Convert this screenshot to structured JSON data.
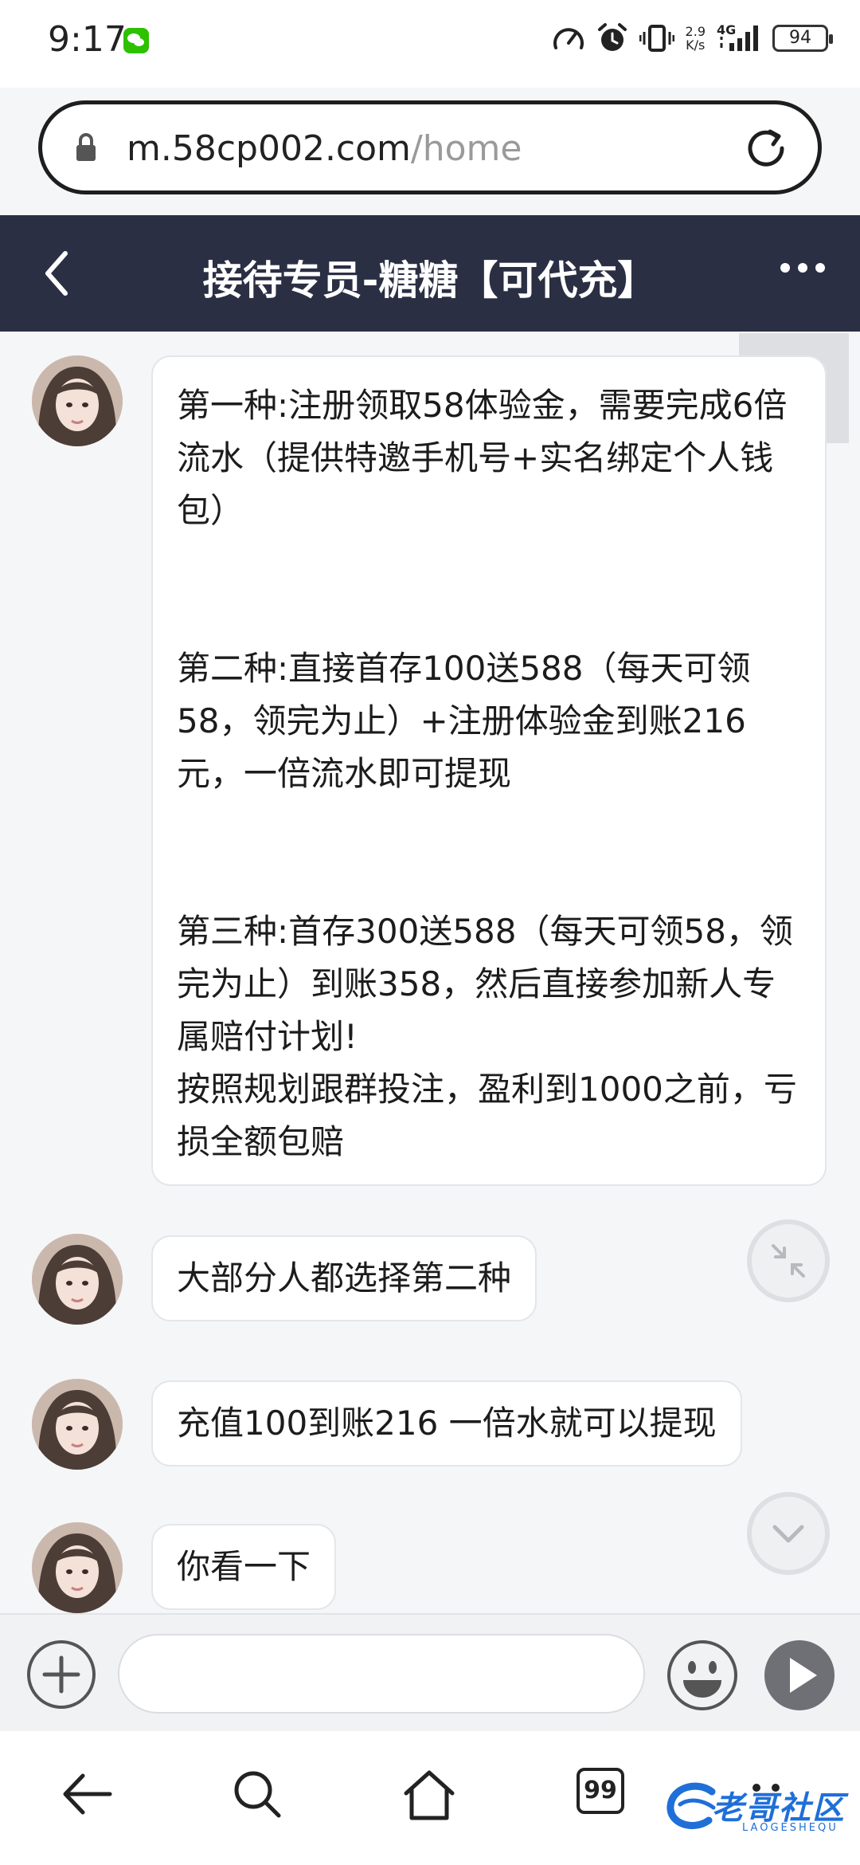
{
  "status_bar": {
    "time": "9:17",
    "net_speed_value": "2.9",
    "net_speed_unit": "K/s",
    "network_type": "4G",
    "battery": "94",
    "icons": [
      "wechat-icon",
      "speedometer-icon",
      "alarm-icon",
      "vibrate-icon",
      "signal-icon"
    ]
  },
  "browser": {
    "url_domain": "m.58cp002.com",
    "url_path": "/home",
    "icons": [
      "lock-icon",
      "reload-icon"
    ]
  },
  "chat": {
    "title": "接待专员-糖糖【可代充】",
    "icons": [
      "back-icon",
      "more-icon"
    ]
  },
  "messages": [
    {
      "sender": "agent",
      "paragraphs": [
        "第一种:注册领取58体验金，需要完成6倍流水（提供特邀手机号+实名绑定个人钱包）",
        "第二种:直接首存100送588（每天可领58，领完为止）+注册体验金到账216元，一倍流水即可提现",
        "第三种:首存300送588（每天可领58，领完为止）到账358，然后直接参加新人专属赔付计划!",
        "按照规划跟群投注，盈利到1000之前，亏损全额包赔"
      ]
    },
    {
      "sender": "agent",
      "text": "大部分人都选择第二种"
    },
    {
      "sender": "agent",
      "text": "充值100到账216 一倍水就可以提现"
    },
    {
      "sender": "agent",
      "text": "你看一下"
    }
  ],
  "input_bar": {
    "placeholder": "",
    "icons": [
      "plus-icon",
      "emoji-icon",
      "send-icon"
    ]
  },
  "bottom_nav": {
    "tab_count": "99",
    "icons": [
      "back-arrow-icon",
      "search-icon",
      "home-icon",
      "tabs-icon",
      "menu-icon"
    ]
  },
  "watermark": {
    "main": "老哥社区",
    "sub": "LAOGESHEQU"
  },
  "colors": {
    "header_bg": "#2b2f44",
    "page_bg": "#f5f6f8",
    "bubble_bg": "#ffffff",
    "watermark": "#1f6fd8",
    "send_button": "#6f7075"
  }
}
